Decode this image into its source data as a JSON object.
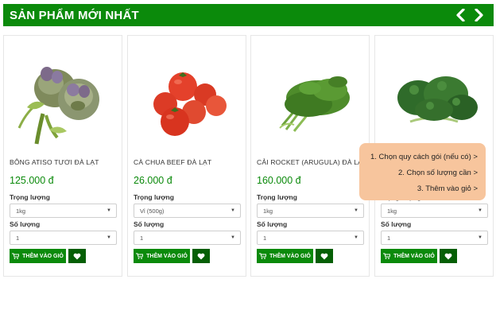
{
  "header": {
    "title": "SẢN PHẨM MỚI NHẤT",
    "prev_icon": "chevron-left-icon",
    "next_icon": "chevron-right-icon"
  },
  "colors": {
    "brand_green": "#0b8a0b",
    "dark_green": "#065f06",
    "tooltip_bg": "#f7c59d"
  },
  "labels": {
    "weight": "Trọng lượng",
    "quantity": "Số lượng",
    "add_to_cart": "THÊM VÀO GIỎ"
  },
  "products": [
    {
      "name": "BÔNG ATISO TƯƠI ĐÀ LẠT",
      "price": "125.000 đ",
      "weight": "1kg",
      "quantity": "1",
      "image": "artichoke"
    },
    {
      "name": "CÀ CHUA BEEF ĐÀ LẠT",
      "price": "26.000 đ",
      "weight": "Vỉ (500g)",
      "quantity": "1",
      "image": "tomatoes"
    },
    {
      "name": "CẢI ROCKET (ARUGULA) ĐÀ LẠT",
      "price": "160.000 đ",
      "weight": "1kg",
      "quantity": "1",
      "image": "arugula"
    },
    {
      "name": "",
      "price": "",
      "weight": "1kg",
      "quantity": "1",
      "image": "kale"
    }
  ],
  "tooltip": {
    "step1": "1.  Chọn quy cách gói (nếu có) >",
    "step2": "2.  Chọn số lượng cần >",
    "step3": "3.  Thêm vào giỏ >"
  }
}
